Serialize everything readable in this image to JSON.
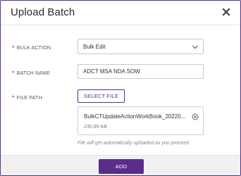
{
  "dialog": {
    "title": "Upload Batch",
    "close_icon": "close-icon"
  },
  "form": {
    "required_marker": "*",
    "bulk_action": {
      "label": "BULK ACTION",
      "value": "Bulk Edit",
      "icon": "chevron-down-icon"
    },
    "batch_name": {
      "label": "BATCH NAME",
      "value": "ADCT MSA NDA SOW"
    },
    "file_path": {
      "label": "FILE PATH",
      "button_label": "SELECT FILE",
      "file": {
        "name": "BulkCTUpdateActionWorkBook_20220...",
        "size": "230.89 KB",
        "remove_icon": "remove-circle-icon"
      },
      "hint": "File will get automatically uploaded as you proceed."
    }
  },
  "footer": {
    "add_label": "ADD"
  },
  "colors": {
    "accent": "#5a2d8a",
    "required": "#d11a1a"
  }
}
